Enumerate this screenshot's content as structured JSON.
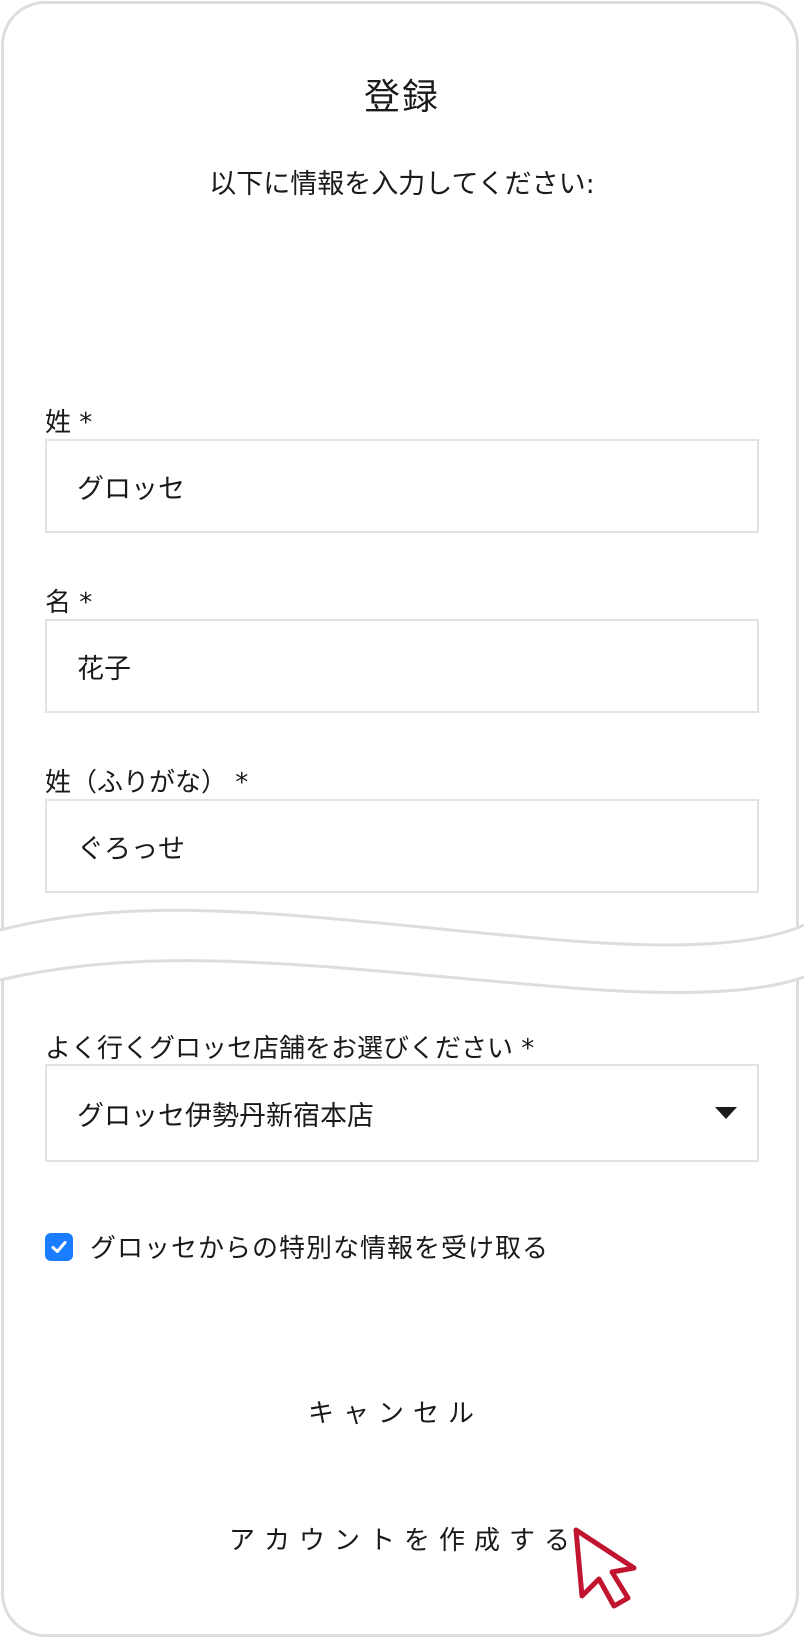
{
  "header": {
    "title": "登録",
    "subtitle": "以下に情報を入力してください:"
  },
  "form": {
    "last_name": {
      "label": "姓 *",
      "value": "グロッセ"
    },
    "first_name": {
      "label": "名 *",
      "value": "花子"
    },
    "last_name_kana": {
      "label": "姓（ふりがな） *",
      "value": "ぐろっせ"
    },
    "store": {
      "label": "よく行くグロッセ店舗をお選びください *",
      "selected": "グロッセ伊勢丹新宿本店"
    },
    "newsletter": {
      "label": "グロッセからの特別な情報を受け取る",
      "checked": true
    }
  },
  "actions": {
    "cancel_label": "キャンセル",
    "create_label": "アカウントを作成する"
  },
  "colors": {
    "accent": "#1a7cff",
    "cursor": "#c0142f",
    "border": "#e3e3e3"
  },
  "icons": {
    "checkbox": "check-icon",
    "dropdown": "chevron-down-icon",
    "cursor": "mouse-pointer-icon"
  }
}
